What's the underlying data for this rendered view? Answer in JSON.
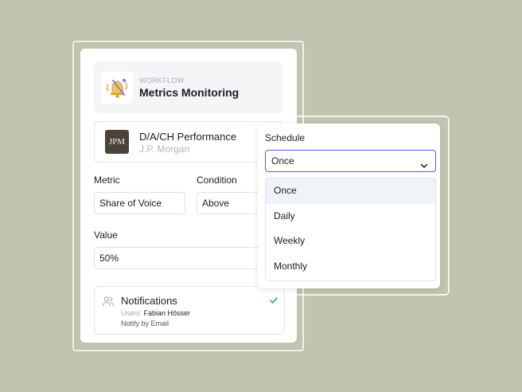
{
  "workflow": {
    "overline": "WORKFLOW",
    "title": "Metrics Monitoring",
    "icon": "bell-alarm-icon"
  },
  "company": {
    "logo_text": "JPM",
    "name": "D/A/CH Performance",
    "subtitle": "J.P. Morgan"
  },
  "metric": {
    "label": "Metric",
    "value": "Share of Voice"
  },
  "condition": {
    "label": "Condition",
    "value": "Above"
  },
  "value_field": {
    "label": "Value",
    "value": "50%"
  },
  "notifications": {
    "title": "Notifications",
    "users_prefix": "Users:",
    "users": "Fabian Hösser",
    "method": "Notify by Email",
    "icon": "users-icon",
    "status_icon": "check-icon"
  },
  "schedule": {
    "label": "Schedule",
    "selected": "Once",
    "options": [
      "Once",
      "Daily",
      "Weekly",
      "Monthly"
    ]
  },
  "colors": {
    "background": "#c1c4ae",
    "accent": "#4a63d8",
    "check": "#3a9f72",
    "logo_bg": "#4a423b"
  }
}
